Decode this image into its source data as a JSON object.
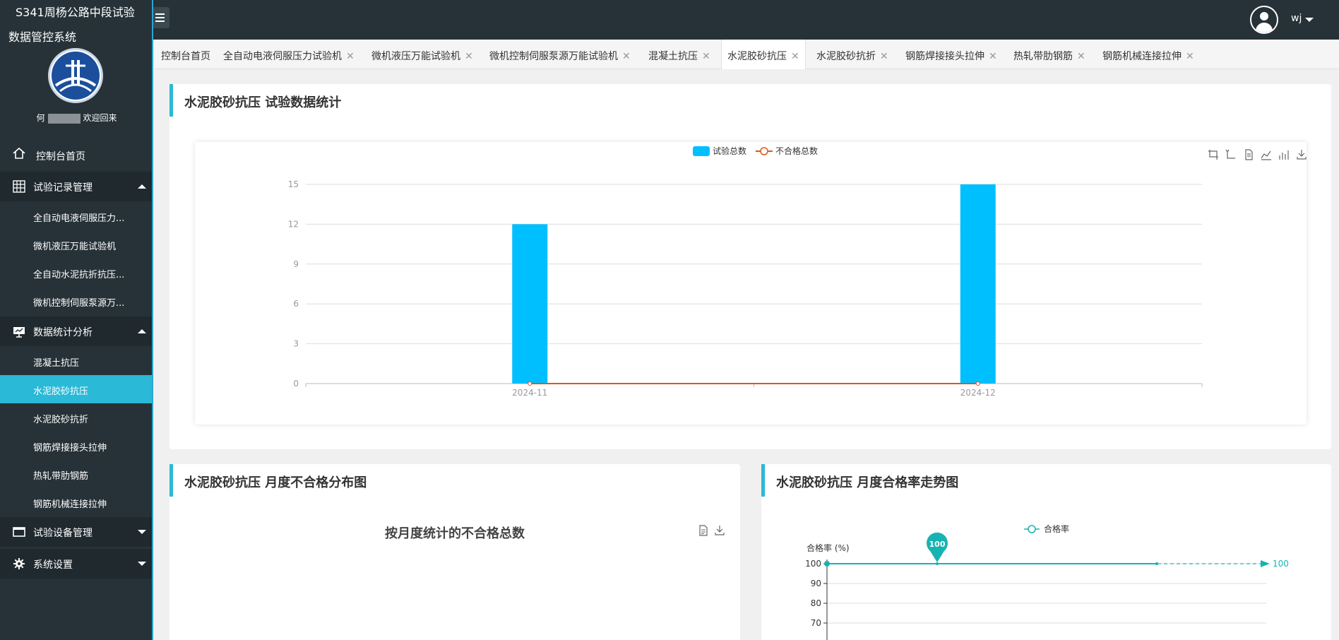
{
  "app": {
    "title_line1": "S341周杨公路中段试验",
    "title_line2": "数据管控系统",
    "welcome_prefix": "何",
    "welcome_suffix": "欢迎回来"
  },
  "header": {
    "user": "wj"
  },
  "sidebar": {
    "home": "控制台首页",
    "groups": [
      {
        "label": "试验记录管理",
        "items": [
          "全自动电液伺服压力...",
          "微机液压万能试验机",
          "全自动水泥抗折抗压...",
          "微机控制伺服泵源万..."
        ]
      },
      {
        "label": "数据统计分析",
        "items": [
          "混凝土抗压",
          "水泥胶砂抗压",
          "水泥胶砂抗折",
          "钢筋焊接接头拉伸",
          "热轧带肋钢筋",
          "钢筋机械连接拉伸"
        ]
      },
      {
        "label": "试验设备管理"
      },
      {
        "label": "系统设置"
      }
    ]
  },
  "tabs": [
    {
      "label": "控制台首页",
      "closable": false
    },
    {
      "label": "全自动电液伺服压力试验机",
      "closable": true
    },
    {
      "label": "微机液压万能试验机",
      "closable": true
    },
    {
      "label": "微机控制伺服泵源万能试验机",
      "closable": true
    },
    {
      "label": "混凝土抗压",
      "closable": true
    },
    {
      "label": "水泥胶砂抗压",
      "closable": true,
      "active": true
    },
    {
      "label": "水泥胶砂抗折",
      "closable": true
    },
    {
      "label": "钢筋焊接接头拉伸",
      "closable": true
    },
    {
      "label": "热轧带肋钢筋",
      "closable": true
    },
    {
      "label": "钢筋机械连接拉伸",
      "closable": true
    }
  ],
  "panels": {
    "stats_title": "水泥胶砂抗压 试验数据统计",
    "monthly_fail_title": "水泥胶砂抗压 月度不合格分布图",
    "monthly_rate_title": "水泥胶砂抗压 月度合格率走势图"
  },
  "colors": {
    "accent": "#2ab9d6",
    "bar": "#00bfff",
    "fail_line": "#e2541f",
    "rate_line": "#17b3b3"
  },
  "chart_data": [
    {
      "type": "bar",
      "categories": [
        "2024-11",
        "2024-12"
      ],
      "series": [
        {
          "name": "试验总数",
          "type": "bar",
          "values": [
            12,
            15
          ]
        },
        {
          "name": "不合格总数",
          "type": "line",
          "values": [
            0,
            0
          ]
        }
      ],
      "ylim": [
        0,
        15
      ],
      "yticks": [
        0,
        3,
        6,
        9,
        12,
        15
      ],
      "grid": true,
      "legend": "top-center",
      "toolbox": [
        "zoom-icon",
        "zoom-reset-icon",
        "data-view-icon",
        "line-toggle-icon",
        "bar-toggle-icon",
        "download-icon"
      ]
    },
    {
      "type": "pie",
      "title": "按月度统计的不合格总数",
      "values": [],
      "toolbox": [
        "data-view-icon",
        "download-icon"
      ]
    },
    {
      "type": "line",
      "series": [
        {
          "name": "合格率",
          "values": [
            100,
            100,
            100
          ]
        }
      ],
      "ylabel": "合格率 (%)",
      "yticks": [
        70,
        80,
        90,
        100
      ],
      "max_marker": "100",
      "markline_label": "100",
      "legend": "top-center"
    }
  ]
}
